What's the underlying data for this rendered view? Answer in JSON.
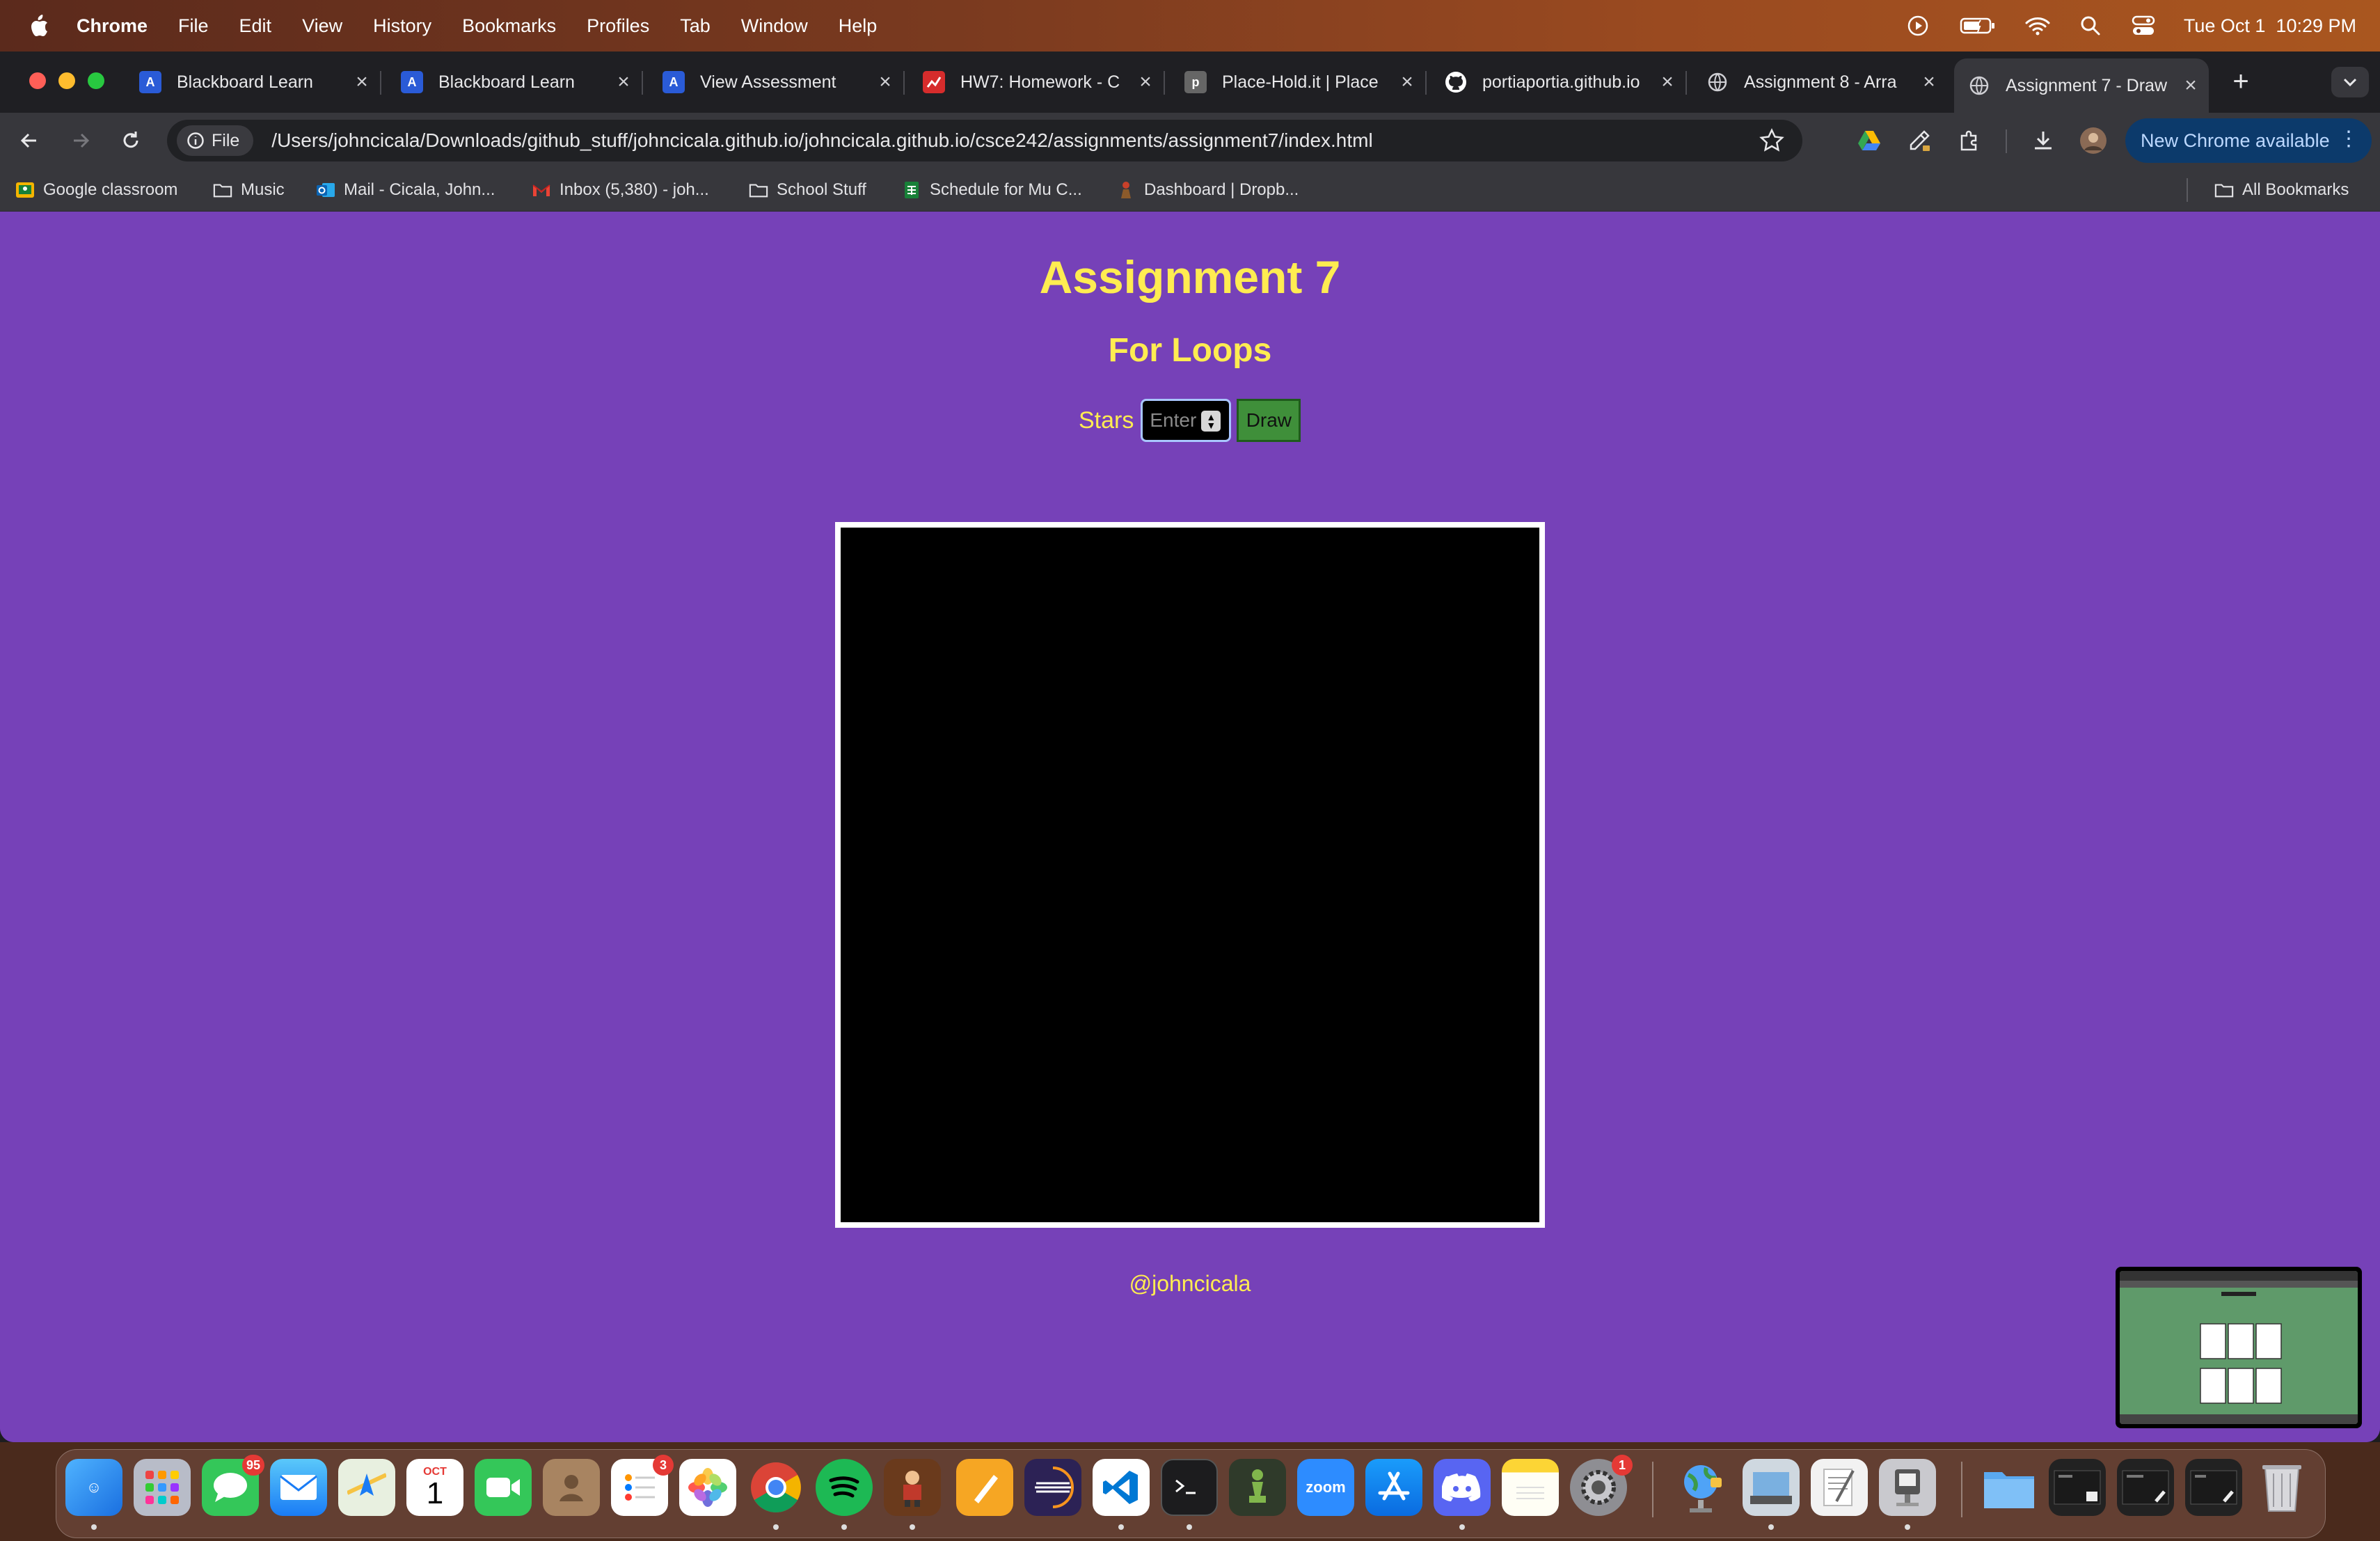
{
  "menubar": {
    "app": "Chrome",
    "items": [
      "File",
      "Edit",
      "View",
      "History",
      "Bookmarks",
      "Profiles",
      "Tab",
      "Window",
      "Help"
    ],
    "datetime": "Tue Oct 1  10:29 PM"
  },
  "tabs": [
    {
      "title": "Blackboard Learn",
      "icon": "blackboard-icon",
      "color": "#2a5bd7"
    },
    {
      "title": "Blackboard Learn",
      "icon": "blackboard-icon",
      "color": "#2a5bd7"
    },
    {
      "title": "View Assessment",
      "icon": "blackboard-icon",
      "color": "#2a5bd7"
    },
    {
      "title": "HW7: Homework - C",
      "icon": "chart-icon",
      "color": "#d62c2c"
    },
    {
      "title": "Place-Hold.it | Place",
      "icon": "placeholder-icon",
      "color": "#666666"
    },
    {
      "title": "portiaportia.github.io",
      "icon": "github-icon",
      "color": "#ffffff"
    },
    {
      "title": "Assignment 8 - Arra",
      "icon": "globe-icon",
      "color": "#aaaaaa"
    },
    {
      "title": "Assignment 7 - Draw",
      "icon": "globe-icon",
      "color": "#aaaaaa",
      "active": true
    }
  ],
  "toolbar": {
    "file_chip": "File",
    "url": "/Users/johncicala/Downloads/github_stuff/johncicala.github.io/johncicala.github.io/csce242/assignments/assignment7/index.html",
    "update_button": "New Chrome available"
  },
  "bookmarks": {
    "items": [
      "Google classroom",
      "Music",
      "Mail - Cicala, John...",
      "Inbox (5,380) - joh...",
      "School Stuff",
      "Schedule for Mu C...",
      "Dashboard | Dropb..."
    ],
    "all": "All Bookmarks"
  },
  "page": {
    "title": "Assignment 7",
    "subtitle": "For Loops",
    "stars_label": "Stars",
    "stars_placeholder": "Enter",
    "draw_button": "Draw",
    "footer": "@johncicala"
  },
  "colors": {
    "page_bg": "#7641b8",
    "heading": "#ffec51",
    "draw_button": "#3f8f3a"
  },
  "dock": {
    "messages_badge": "95",
    "calendar_month": "OCT",
    "calendar_day": "1",
    "reminders_badge": "3",
    "settings_badge": "1"
  }
}
